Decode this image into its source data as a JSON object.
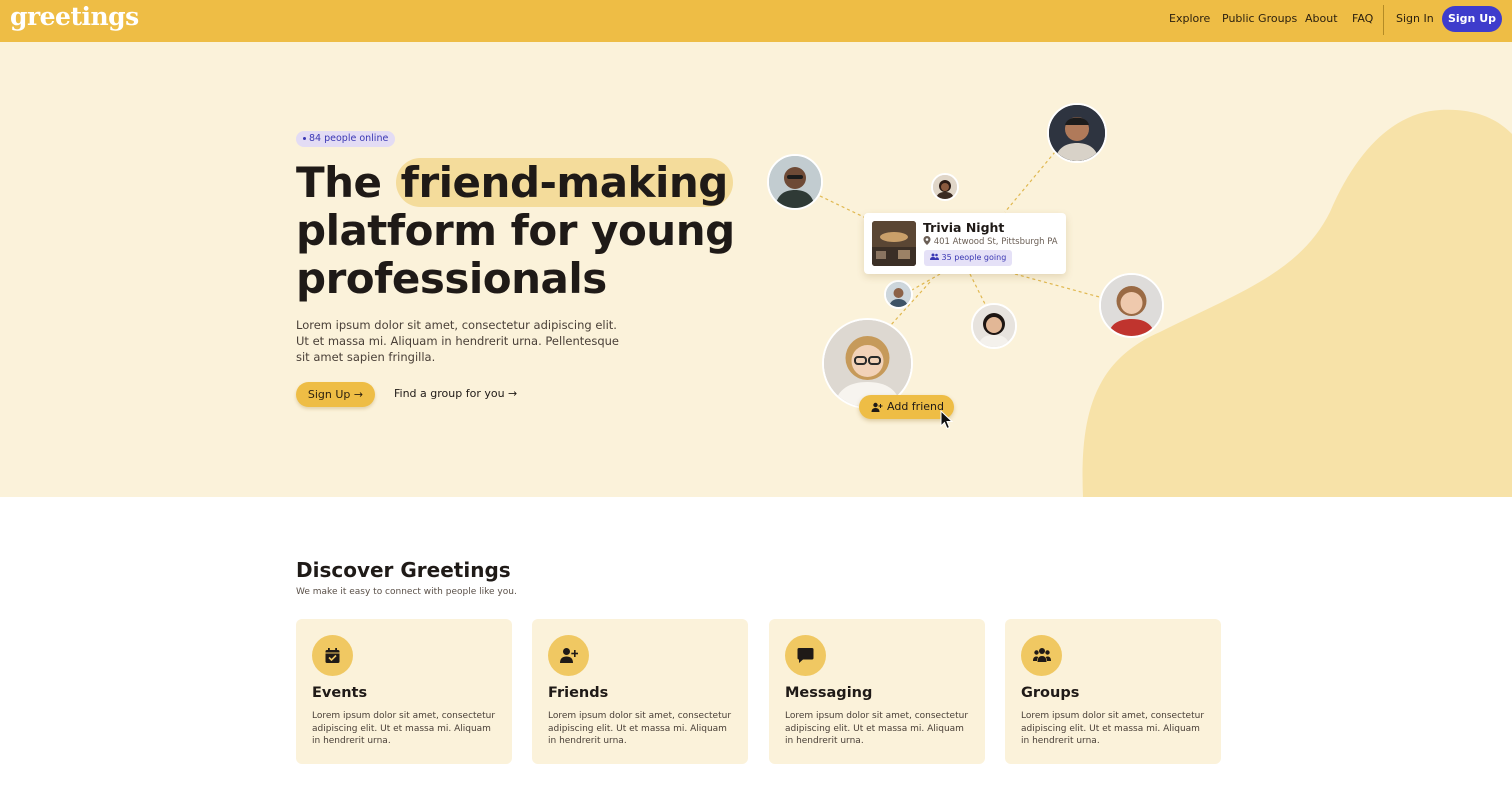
{
  "nav": {
    "logo": "greetings",
    "links": [
      "Explore",
      "Public Groups",
      "About",
      "FAQ"
    ],
    "sign_in": "Sign In",
    "sign_up": "Sign Up"
  },
  "hero": {
    "online_badge": "84 people online",
    "title_prefix": "The",
    "title_highlight": "friend-making",
    "title_line2": "platform for young",
    "title_line3": "professionals",
    "body": "Lorem ipsum dolor sit amet, consectetur adipiscing elit. Ut et massa mi. Aliquam in hendrerit urna. Pellentesque sit amet sapien fringilla.",
    "signup_button": "Sign Up →",
    "find_group_link": "Find a group for you →"
  },
  "event_card": {
    "title": "Trivia Night",
    "address": "401 Atwood St, Pittsburgh PA",
    "going": "35 people going"
  },
  "add_friend_button": "Add friend",
  "discover": {
    "title": "Discover Greetings",
    "subtitle": "We make it easy to connect with people like you.",
    "cards": [
      {
        "title": "Events",
        "icon": "calendar-check-icon",
        "body": "Lorem ipsum dolor sit amet, consectetur adipiscing elit. Ut et massa mi. Aliquam in hendrerit urna."
      },
      {
        "title": "Friends",
        "icon": "user-plus-icon",
        "body": "Lorem ipsum dolor sit amet, consectetur adipiscing elit. Ut et massa mi. Aliquam in hendrerit urna."
      },
      {
        "title": "Messaging",
        "icon": "chat-bubble-icon",
        "body": "Lorem ipsum dolor sit amet, consectetur adipiscing elit. Ut et massa mi. Aliquam in hendrerit urna."
      },
      {
        "title": "Groups",
        "icon": "users-group-icon",
        "body": "Lorem ipsum dolor sit amet, consectetur adipiscing elit. Ut et massa mi. Aliquam in hendrerit urna."
      }
    ]
  },
  "colors": {
    "nav_bg": "#eebd45",
    "hero_bg": "#fbf2da",
    "blob": "#f7e2a8",
    "accent_purple": "#3e3ccc",
    "card_bg": "#fbf2da"
  }
}
